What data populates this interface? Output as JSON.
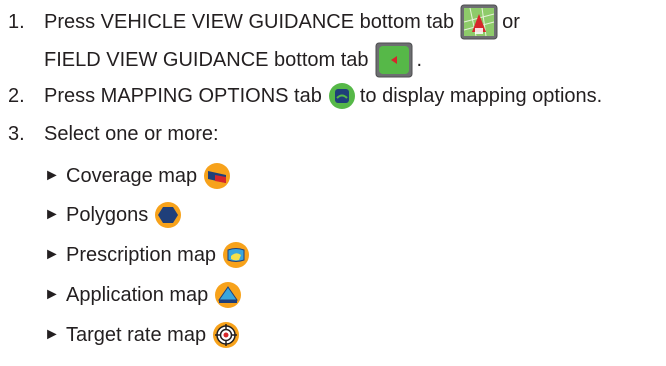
{
  "steps": [
    {
      "number": "1.",
      "line1_text": "Press VEHICLE VIEW GUIDANCE bottom tab",
      "line1_suffix": "or",
      "line2_text": "FIELD VIEW GUIDANCE bottom tab",
      "line2_suffix": "."
    },
    {
      "number": "2.",
      "text_before": "Press MAPPING OPTIONS tab",
      "text_after": "to display mapping options."
    },
    {
      "number": "3.",
      "text": "Select one or more:"
    }
  ],
  "options": [
    {
      "label": "Coverage map",
      "icon": "coverage-map-icon"
    },
    {
      "label": "Polygons",
      "icon": "polygons-icon"
    },
    {
      "label": "Prescription map",
      "icon": "prescription-map-icon"
    },
    {
      "label": "Application map",
      "icon": "application-map-icon"
    },
    {
      "label": "Target rate map",
      "icon": "target-rate-map-icon"
    }
  ],
  "bullet_glyph": "►",
  "colors": {
    "text": "#231f20",
    "icon_orange": "#f7a21b",
    "icon_green": "#56b848",
    "icon_navy": "#1f3f7a",
    "icon_red": "#d6262a"
  }
}
